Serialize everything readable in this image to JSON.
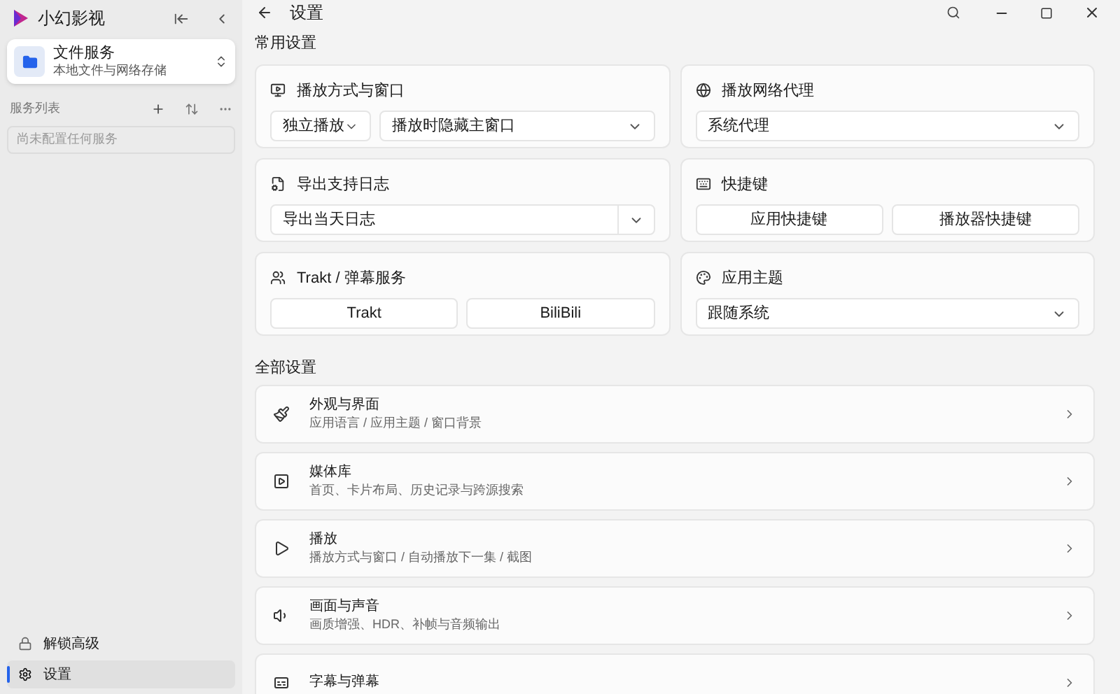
{
  "sidebar": {
    "app_title": "小幻影视",
    "source": {
      "title": "文件服务",
      "subtitle": "本地文件与网络存储"
    },
    "section_label": "服务列表",
    "empty_text": "尚未配置任何服务",
    "bottom_items": [
      {
        "label": "解锁高级",
        "selected": false
      },
      {
        "label": "设置",
        "selected": true
      }
    ]
  },
  "header": {
    "title": "设置"
  },
  "common": {
    "heading": "常用设置",
    "cards": [
      {
        "title": "播放方式与窗口",
        "controls": [
          {
            "kind": "dropdown-compact",
            "label": "独立播放"
          },
          {
            "kind": "dropdown",
            "label": "播放时隐藏主窗口"
          }
        ]
      },
      {
        "title": "播放网络代理",
        "controls": [
          {
            "kind": "dropdown",
            "label": "系统代理"
          }
        ]
      },
      {
        "title": "导出支持日志",
        "controls": [
          {
            "kind": "split-dropdown",
            "label": "导出当天日志"
          }
        ]
      },
      {
        "title": "快捷键",
        "controls": [
          {
            "kind": "button",
            "label": "应用快捷键"
          },
          {
            "kind": "button",
            "label": "播放器快捷键"
          }
        ]
      },
      {
        "title": "Trakt / 弹幕服务",
        "controls": [
          {
            "kind": "button",
            "label": "Trakt"
          },
          {
            "kind": "button",
            "label": "BiliBili"
          }
        ]
      },
      {
        "title": "应用主题",
        "controls": [
          {
            "kind": "dropdown",
            "label": "跟随系统"
          }
        ]
      }
    ]
  },
  "all": {
    "heading": "全部设置",
    "items": [
      {
        "title": "外观与界面",
        "subtitle": "应用语言 / 应用主题 / 窗口背景"
      },
      {
        "title": "媒体库",
        "subtitle": "首页、卡片布局、历史记录与跨源搜索"
      },
      {
        "title": "播放",
        "subtitle": "播放方式与窗口 / 自动播放下一集 / 截图"
      },
      {
        "title": "画面与声音",
        "subtitle": "画质增强、HDR、补帧与音频输出"
      },
      {
        "title": "字幕与弹幕"
      }
    ]
  }
}
